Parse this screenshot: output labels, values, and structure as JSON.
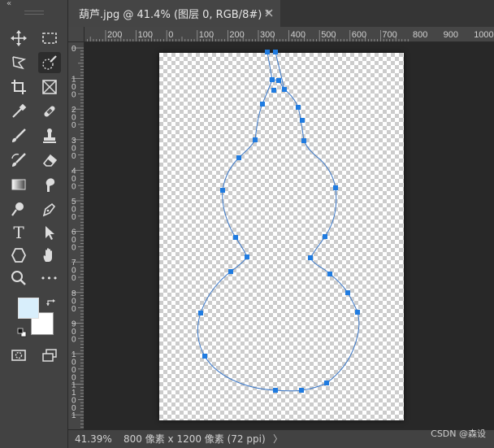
{
  "toolbar": {
    "collapse_glyph": "«",
    "tools": [
      {
        "id": "move",
        "icon": "move-icon"
      },
      {
        "id": "marquee",
        "icon": "rect-marquee-icon"
      },
      {
        "id": "lasso",
        "icon": "polygonal-lasso-icon"
      },
      {
        "id": "quick-select",
        "icon": "quick-selection-icon",
        "active": true
      },
      {
        "id": "crop",
        "icon": "crop-icon"
      },
      {
        "id": "frame",
        "icon": "frame-icon"
      },
      {
        "id": "eyedropper",
        "icon": "eyedropper-icon"
      },
      {
        "id": "healing",
        "icon": "healing-brush-icon"
      },
      {
        "id": "brush",
        "icon": "brush-icon"
      },
      {
        "id": "stamp",
        "icon": "clone-stamp-icon"
      },
      {
        "id": "history-brush",
        "icon": "history-brush-icon"
      },
      {
        "id": "eraser",
        "icon": "eraser-icon"
      },
      {
        "id": "gradient",
        "icon": "gradient-icon"
      },
      {
        "id": "blur",
        "icon": "smudge-icon"
      },
      {
        "id": "dodge",
        "icon": "dodge-icon"
      },
      {
        "id": "pen",
        "icon": "pen-icon"
      },
      {
        "id": "type",
        "icon": "type-icon",
        "text": "T"
      },
      {
        "id": "path-select",
        "icon": "path-selection-icon"
      },
      {
        "id": "shape",
        "icon": "polygon-shape-icon"
      },
      {
        "id": "hand",
        "icon": "hand-icon"
      },
      {
        "id": "zoom",
        "icon": "zoom-icon"
      },
      {
        "id": "more",
        "icon": "more-icon",
        "text": "•••"
      },
      {
        "id": "quick-mask",
        "icon": "quick-mask-icon"
      },
      {
        "id": "screen-mode",
        "icon": "screen-mode-icon"
      }
    ],
    "foreground_color": "#d8eefb",
    "background_color": "#ffffff"
  },
  "tab": {
    "title": "葫芦.jpg @ 41.4% (图层 0, RGB/8#) *"
  },
  "ruler": {
    "top_labels": [
      "200",
      "100",
      "0",
      "100",
      "200",
      "300",
      "400",
      "500",
      "600",
      "700",
      "800",
      "900",
      "1000"
    ],
    "left_labels": [
      "0",
      "1 0 0",
      "2 0 0",
      "3 0 0",
      "4 0 0",
      "5 0 0",
      "6 0 0",
      "7 0 0",
      "8 0 0",
      "9 0 0",
      "1 0 0 0",
      "1 1 0 0",
      "1"
    ]
  },
  "status": {
    "zoom": "41.39%",
    "doc_info": "800 像素 x 1200 像素 (72 ppi)",
    "arrow": "〉",
    "watermark": "CSDN @森设"
  },
  "colors": {
    "path_stroke": "#3b78c8",
    "anchor": "#1f7be0",
    "workspace": "#282828",
    "panel": "#424242"
  }
}
